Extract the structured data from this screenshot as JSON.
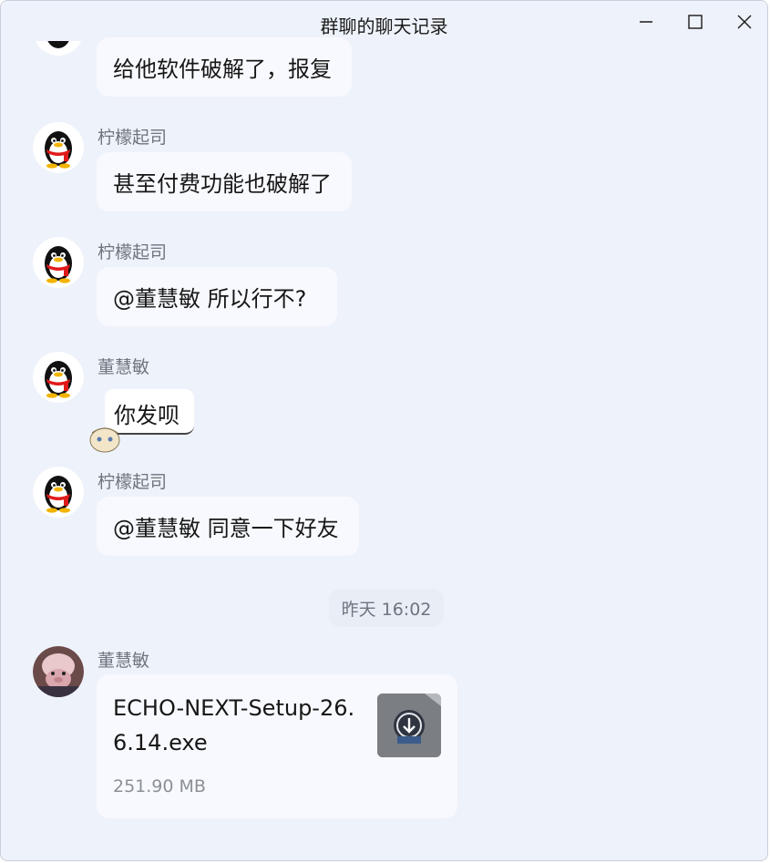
{
  "window": {
    "title": "群聊的聊天记录",
    "controls": [
      "minimize-icon",
      "maximize-icon",
      "close-icon"
    ]
  },
  "messages": [
    {
      "sender": "",
      "avatar": "qq-penguin",
      "text": "给他软件破解了，报复"
    },
    {
      "sender": "柠檬起司",
      "avatar": "qq-penguin",
      "text": "甚至付费功能也破解了"
    },
    {
      "sender": "柠檬起司",
      "avatar": "qq-penguin",
      "text": "@董慧敏 所以行不?"
    },
    {
      "sender": "董慧敏",
      "avatar": "qq-penguin",
      "text": "你发呗"
    },
    {
      "sender": "柠檬起司",
      "avatar": "qq-penguin",
      "text": "@董慧敏 同意一下好友"
    }
  ],
  "timestamp": "昨天 16:02",
  "file_message": {
    "sender": "董慧敏",
    "avatar": "photo-avatar",
    "file_name": "ECHO-NEXT-Setup-26.6.14.exe",
    "file_size": "251.90 MB",
    "icon": "exe-file-icon"
  },
  "colors": {
    "window_bg": "#eef2fa",
    "bubble_bg": "#f8f9fe",
    "secondary_text": "#6f747d"
  }
}
